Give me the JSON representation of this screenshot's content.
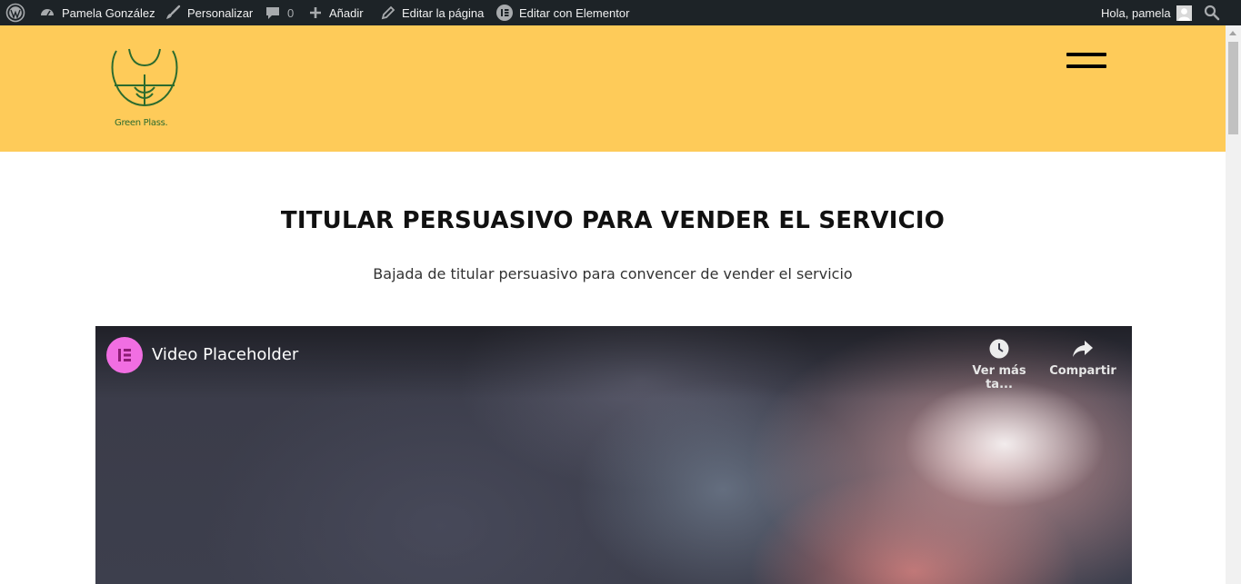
{
  "adminbar": {
    "site_name": "Pamela González",
    "customize": "Personalizar",
    "comments_count": "0",
    "add_new": "Añadir",
    "edit_page": "Editar la página",
    "edit_elementor": "Editar con Elementor",
    "greeting": "Hola, pamela"
  },
  "header": {
    "logo_text": "Green Plass."
  },
  "main": {
    "headline": "TITULAR PERSUASIVO PARA VENDER EL SERVICIO",
    "subheadline": "Bajada de titular persuasivo para convencer de vender el servicio"
  },
  "video": {
    "title": "Video Placeholder",
    "watch_later": "Ver más ta...",
    "share": "Compartir"
  },
  "colors": {
    "adminbar_bg": "#1d2327",
    "header_bg": "#fecb59",
    "logo_green": "#2c6b2e",
    "elementor_pink": "#f16ee2"
  }
}
